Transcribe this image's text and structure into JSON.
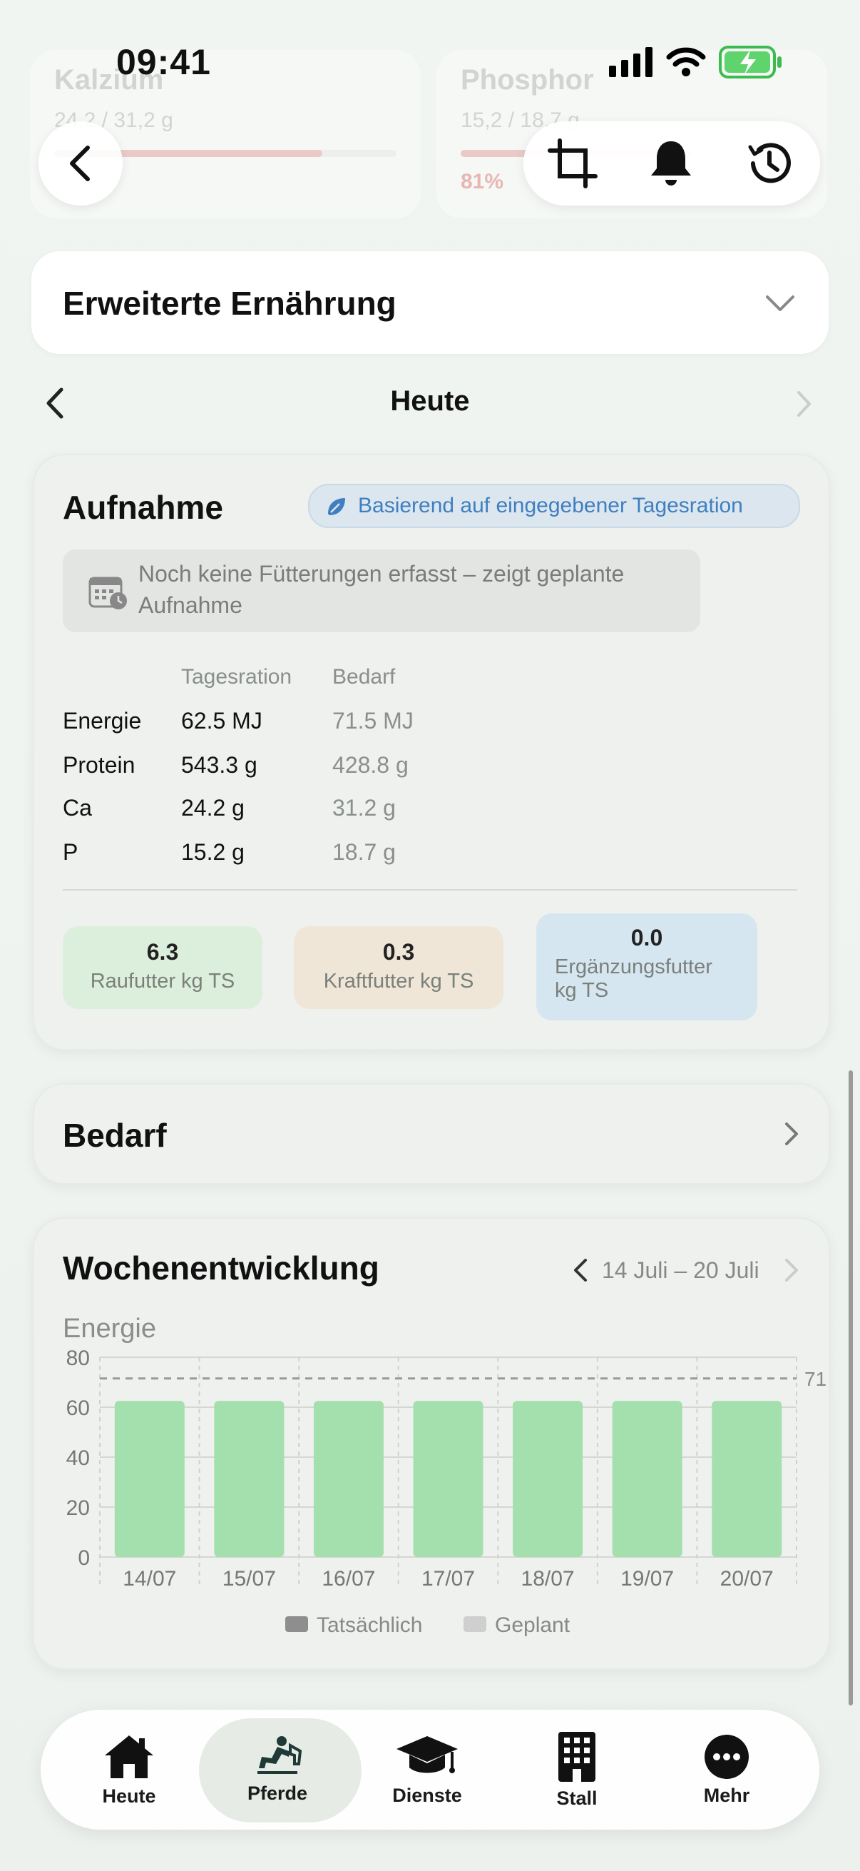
{
  "status": {
    "time": "09:41"
  },
  "bg_cards": {
    "calcium": {
      "title": "Kalzium",
      "sub": "24,2 / 31,2 g"
    },
    "phosphor": {
      "title": "Phosphor",
      "sub": "15,2 / 18,7 g",
      "percent": "81%"
    }
  },
  "advanced": {
    "title": "Erweiterte Ernährung"
  },
  "day_nav": {
    "label": "Heute"
  },
  "intake": {
    "title": "Aufnahme",
    "badge": "Basierend auf eingegebener Tagesration",
    "notice_line1": "Noch keine Fütterungen erfasst – zeigt geplante",
    "notice_line2": "Aufnahme",
    "col_ration": "Tagesration",
    "col_need": "Bedarf",
    "rows": [
      {
        "label": "Energie",
        "ration": "62.5 MJ",
        "need": "71.5 MJ"
      },
      {
        "label": "Protein",
        "ration": "543.3 g",
        "need": "428.8 g"
      },
      {
        "label": "Ca",
        "ration": "24.2 g",
        "need": "31.2 g"
      },
      {
        "label": "P",
        "ration": "15.2 g",
        "need": "18.7 g"
      }
    ],
    "chips": [
      {
        "value": "6.3",
        "label": "Raufutter kg TS",
        "color": "#dcefdc"
      },
      {
        "value": "0.3",
        "label": "Kraftfutter kg TS",
        "color": "#efe6d8"
      },
      {
        "value": "0.0",
        "label_line1": "Ergänzungsfutter",
        "label_line2": "kg TS",
        "color": "#d6e6f0"
      }
    ]
  },
  "need": {
    "title": "Bedarf"
  },
  "weekly": {
    "title": "Wochenentwicklung",
    "range": "14 Juli – 20 Juli"
  },
  "chart_data": {
    "type": "bar",
    "title": "Energie",
    "categories": [
      "14/07",
      "15/07",
      "16/07",
      "17/07",
      "18/07",
      "19/07",
      "20/07"
    ],
    "series": [
      {
        "name": "Geplant",
        "values": [
          62.5,
          62.5,
          62.5,
          62.5,
          62.5,
          62.5,
          62.5
        ],
        "color": "#a4e0ae"
      }
    ],
    "reference_line": {
      "value": 71.5,
      "label": "71"
    },
    "ylim": [
      0,
      80
    ],
    "yticks": [
      "0",
      "20",
      "40",
      "60",
      "80"
    ],
    "legend": [
      {
        "label": "Tatsächlich",
        "color": "#8e8e8e"
      },
      {
        "label": "Geplant",
        "color": "#cfcfcf"
      }
    ],
    "legend_placement": "bottom",
    "grid": true
  },
  "tabbar": {
    "items": [
      {
        "label": "Heute",
        "icon": "home-icon"
      },
      {
        "label": "Pferde",
        "icon": "horse-rider-icon",
        "active": true
      },
      {
        "label": "Dienste",
        "icon": "graduation-cap-icon"
      },
      {
        "label": "Stall",
        "icon": "building-icon"
      },
      {
        "label": "Mehr",
        "icon": "more-icon"
      }
    ]
  },
  "colors": {
    "accent_blue": "#3f7fc0",
    "badge_bg": "#dce6ee",
    "bar_green": "#a4e0ae",
    "warning_red": "#e07a7a"
  }
}
